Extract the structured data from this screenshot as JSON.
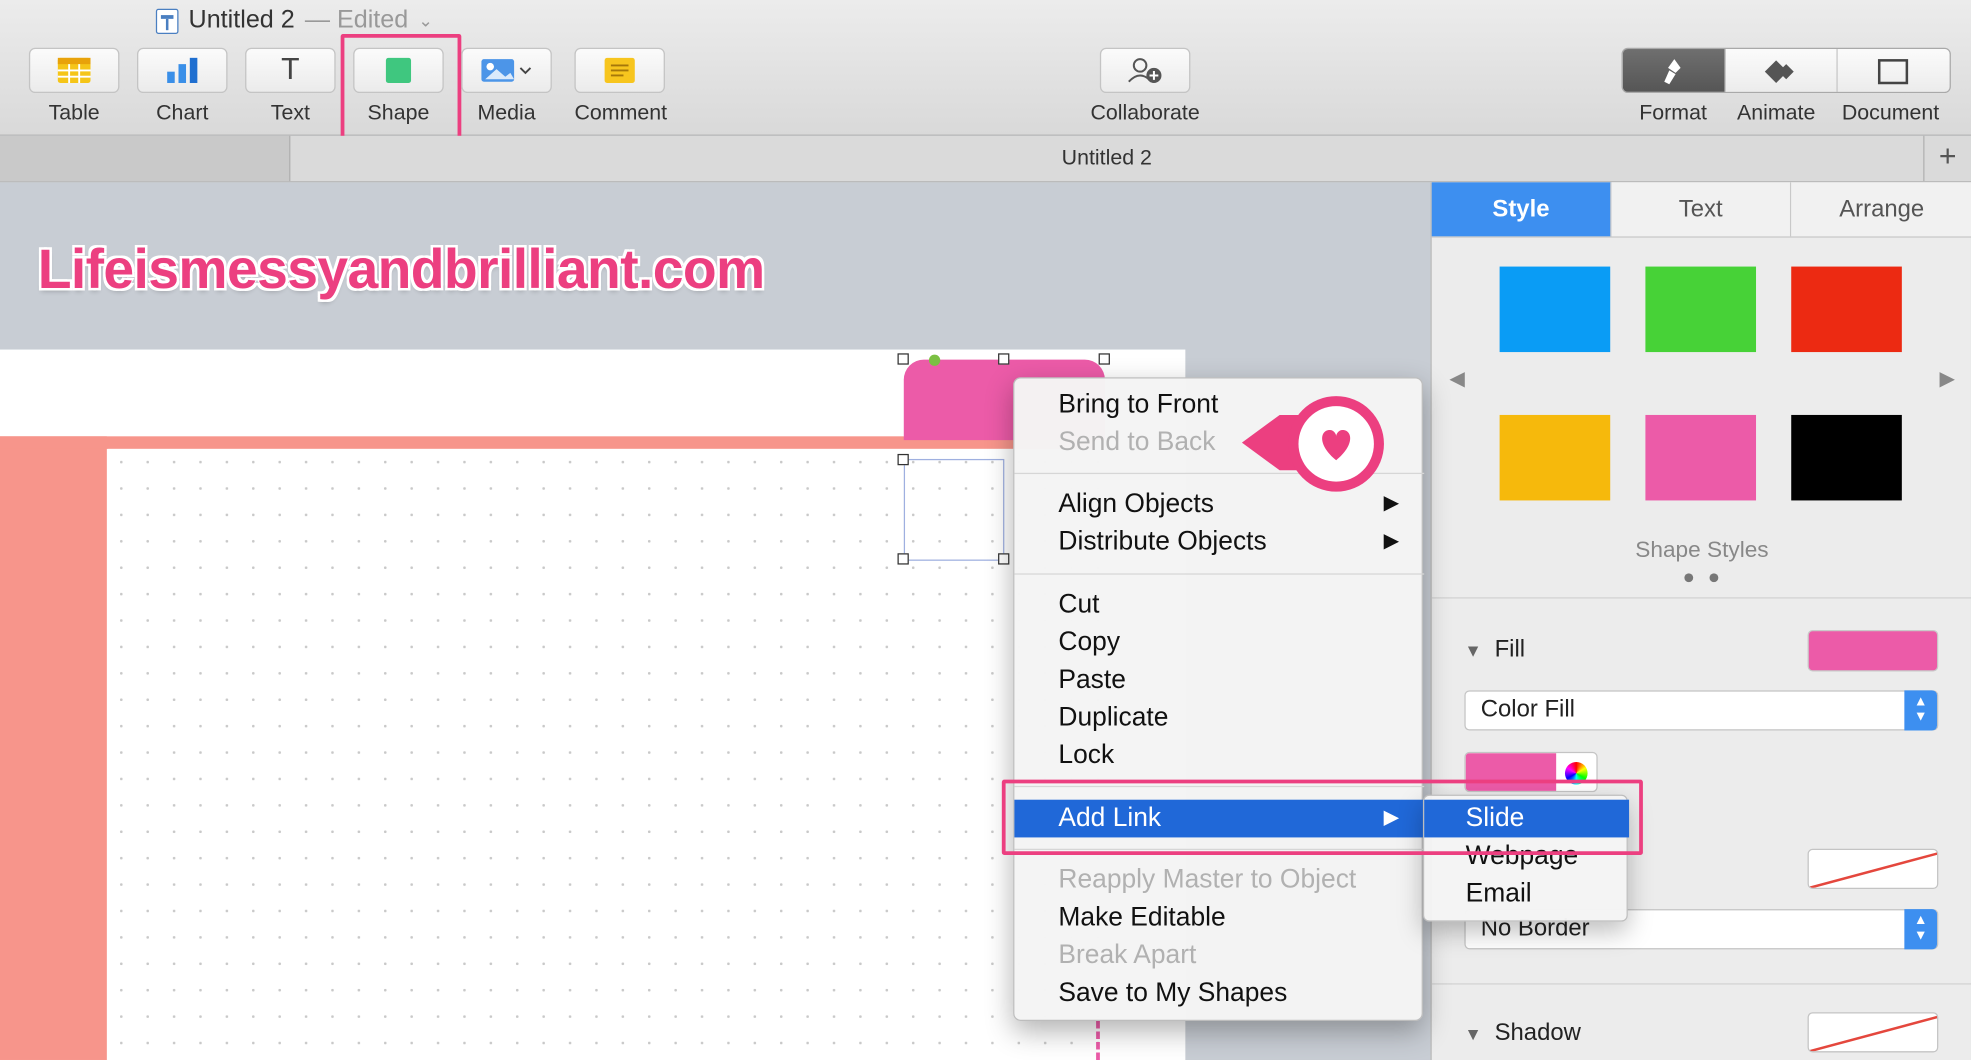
{
  "window": {
    "title": "Untitled 2",
    "title_suffix": "— Edited",
    "doc_icon": "keynote-doc-icon"
  },
  "toolbar": {
    "items": [
      {
        "label": "Table",
        "icon": "table-icon"
      },
      {
        "label": "Chart",
        "icon": "chart-icon"
      },
      {
        "label": "Text",
        "icon": "text-icon"
      },
      {
        "label": "Shape",
        "icon": "shape-icon",
        "highlighted": true
      },
      {
        "label": "Media",
        "icon": "media-icon"
      },
      {
        "label": "Comment",
        "icon": "comment-icon"
      },
      {
        "label": "Collaborate",
        "icon": "collaborate-icon"
      },
      {
        "label": "Format",
        "icon": "paintbrush-icon",
        "active": true
      },
      {
        "label": "Animate",
        "icon": "diamond-icon"
      },
      {
        "label": "Document",
        "icon": "document-icon"
      }
    ]
  },
  "tabbar": {
    "active_tab": "Untitled 2",
    "add": "+"
  },
  "canvas": {
    "watermark": "Lifeismessyandbrilliant.com"
  },
  "sidebar": {
    "tabs": [
      "Style",
      "Text",
      "Arrange"
    ],
    "active_tab": "Style",
    "swatch_colors": [
      "#0a9cf5",
      "#47d237",
      "#ec2a12",
      "#f6b90c",
      "#ec5ba8",
      "#000000"
    ],
    "shape_styles_label": "Shape Styles",
    "fill": {
      "title": "Fill",
      "color": "#ec5ba8",
      "fill_type": "Color Fill"
    },
    "border": {
      "value": "No Border"
    },
    "shadow": {
      "title": "Shadow"
    }
  },
  "context_menu": {
    "items": [
      {
        "label": "Bring to Front",
        "enabled": true
      },
      {
        "label": "Send to Back",
        "enabled": false
      },
      {
        "label": "Align Objects",
        "enabled": true,
        "submenu": true
      },
      {
        "label": "Distribute Objects",
        "enabled": true,
        "submenu": true
      },
      {
        "label": "Cut",
        "enabled": true
      },
      {
        "label": "Copy",
        "enabled": true
      },
      {
        "label": "Paste",
        "enabled": true
      },
      {
        "label": "Duplicate",
        "enabled": true
      },
      {
        "label": "Lock",
        "enabled": true
      },
      {
        "label": "Add Link",
        "enabled": true,
        "submenu": true,
        "selected": true
      },
      {
        "label": "Reapply Master to Object",
        "enabled": false
      },
      {
        "label": "Make Editable",
        "enabled": true
      },
      {
        "label": "Break Apart",
        "enabled": false
      },
      {
        "label": "Save to My Shapes",
        "enabled": true
      }
    ],
    "submenu_arrow": "▶"
  },
  "link_submenu": {
    "items": [
      {
        "label": "Slide",
        "selected": true
      },
      {
        "label": "Webpage"
      },
      {
        "label": "Email"
      }
    ]
  },
  "colors": {
    "highlight": "#ec3f80",
    "accent": "#3d8ff0",
    "selection": "#2068d8"
  }
}
